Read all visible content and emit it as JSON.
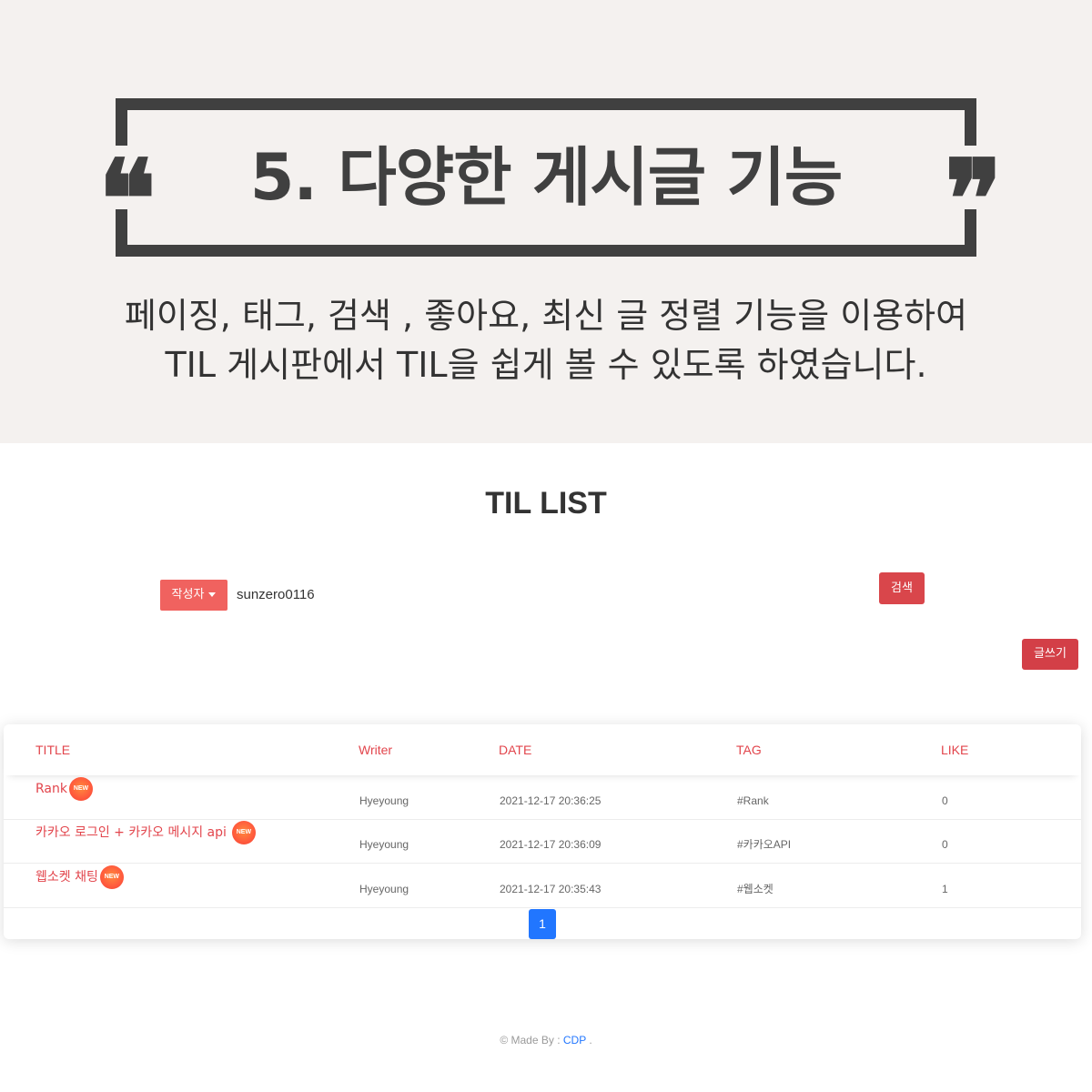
{
  "banner": {
    "title": "5. 다양한 게시글 기능",
    "quote_open": "❝",
    "quote_close": "❞",
    "description": [
      "페이징, 태그, 검색 , 좋아요, 최신 글 정렬 기능을 이용하여",
      "TIL 게시판에서 TIL을 쉽게 볼 수 있도록 하였습니다."
    ]
  },
  "list": {
    "title": "TIL LIST",
    "filter_label": "작성자",
    "search_value": "sunzero0116",
    "search_button": "검색",
    "write_button": "글쓰기",
    "columns": [
      "TITLE",
      "Writer",
      "DATE",
      "TAG",
      "LIKE"
    ],
    "new_badge": "NEW",
    "rows": [
      {
        "title": "Rank",
        "writer": "Hyeyoung",
        "date": "2021-12-17 20:36:25",
        "tag": "#Rank",
        "like": "0"
      },
      {
        "title": "카카오 로그인 + 카카오 메시지 api",
        "writer": "Hyeyoung",
        "date": "2021-12-17 20:36:09",
        "tag": "#카카오API",
        "like": "0"
      },
      {
        "title": "웹소켓 채팅",
        "writer": "Hyeyoung",
        "date": "2021-12-17 20:35:43",
        "tag": "#웹소켓",
        "like": "1"
      }
    ],
    "page": "1"
  },
  "footer": {
    "prefix": "© Made By : ",
    "brand": "CDP",
    "suffix": " ."
  },
  "colors": {
    "banner_bg": "#f4f1ef",
    "frame": "#404040",
    "accent_red": "#e2454c",
    "button_red": "#d9464b",
    "filter_red": "#f0625f",
    "page_blue": "#2176ff"
  }
}
